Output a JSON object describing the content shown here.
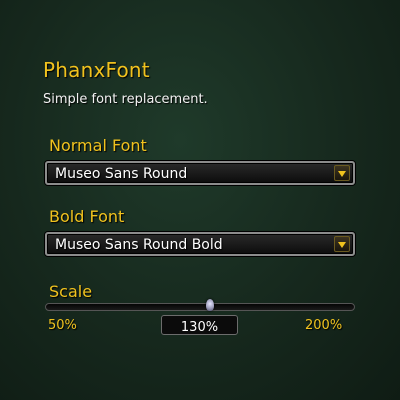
{
  "addon": {
    "title": "PhanxFont",
    "subtitle": "Simple font replacement."
  },
  "normal_font": {
    "label": "Normal Font",
    "value": "Museo Sans Round",
    "button_icon": "chevron-down-icon"
  },
  "bold_font": {
    "label": "Bold Font",
    "value": "Museo Sans Round Bold",
    "button_icon": "chevron-down-icon"
  },
  "scale": {
    "label": "Scale",
    "min_label": "50%",
    "max_label": "200%",
    "value_label": "130%",
    "min": 50,
    "max": 200,
    "value": 130
  },
  "colors": {
    "accent": "#f0c21e",
    "text": "#ffffff",
    "background": "#16281d"
  }
}
